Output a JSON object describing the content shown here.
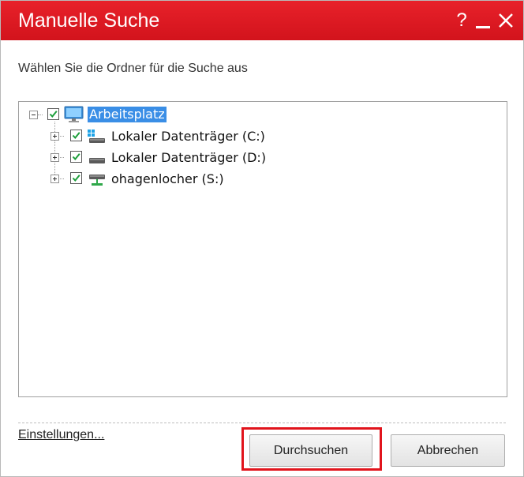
{
  "window": {
    "title": "Manuelle Suche",
    "help_glyph": "?",
    "accent_color": "#dc1a23"
  },
  "instruction": "Wählen Sie die Ordner für die Suche aus",
  "tree": {
    "root": {
      "label": "Arbeitsplatz",
      "checked": true,
      "expanded": true,
      "selected": true,
      "icon": "computer-icon"
    },
    "children": [
      {
        "label": "Lokaler Datenträger (C:)",
        "checked": true,
        "expanded": false,
        "icon": "system-drive-icon"
      },
      {
        "label": "Lokaler Datenträger (D:)",
        "checked": true,
        "expanded": false,
        "icon": "hard-drive-icon"
      },
      {
        "label": "ohagenlocher (S:)",
        "checked": true,
        "expanded": false,
        "icon": "network-drive-icon"
      }
    ]
  },
  "footer": {
    "settings_link": "Einstellungen...",
    "search_button": "Durchsuchen",
    "cancel_button": "Abbrechen"
  }
}
